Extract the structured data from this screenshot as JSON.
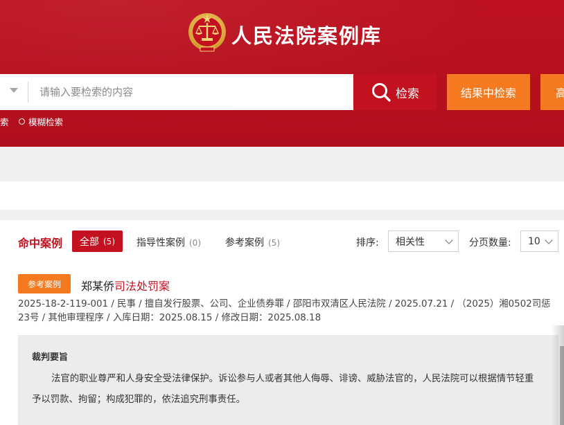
{
  "header": {
    "site_title": "人民法院案例库"
  },
  "search": {
    "placeholder": "请输入要检索的内容",
    "search_button": "检索",
    "result_search_button": "结果中检索",
    "advanced_button_partial": "高",
    "option_left_partial": "索",
    "option_fuzzy": "模糊检索"
  },
  "results": {
    "hit_title": "命中案例",
    "tabs": [
      {
        "label": "全部",
        "count": "(5)"
      },
      {
        "label": "指导性案例",
        "count": "(0)"
      },
      {
        "label": "参考案例",
        "count": "(5)"
      }
    ],
    "sort_label": "排序:",
    "sort_value": "相关性",
    "page_size_label": "分页数量:",
    "page_size_value": "10"
  },
  "case": {
    "badge": "参考案例",
    "title_plain": "郑某侨",
    "title_highlight": "司法处罚案",
    "meta": "2025-18-2-119-001 / 民事 / 擅自发行股票、公司、企业债券罪 / 邵阳市双清区人民法院 / 2025.07.21 / （2025）湘0502司惩23号 / 其他审理程序 / 入库日期：2025.08.15 / 修改日期：2025.08.18",
    "summary_title": "裁判要旨",
    "summary_text": "法官的职业尊严和人身安全受法律保护。诉讼参与人或者其他人侮辱、诽谤、威胁法官的，人民法院可以根据情节轻重予以罚款、拘留；构成犯罪的，依法追究刑事责任。"
  },
  "colors": {
    "header_red": "#b8101f",
    "accent_red": "#c4111f",
    "orange": "#f57a1f",
    "gold": "#e9b64a"
  },
  "icons": {
    "emblem": "court-emblem-icon",
    "search": "search-icon",
    "dropdown": "chevron-down-icon",
    "radio": "radio-icon"
  }
}
